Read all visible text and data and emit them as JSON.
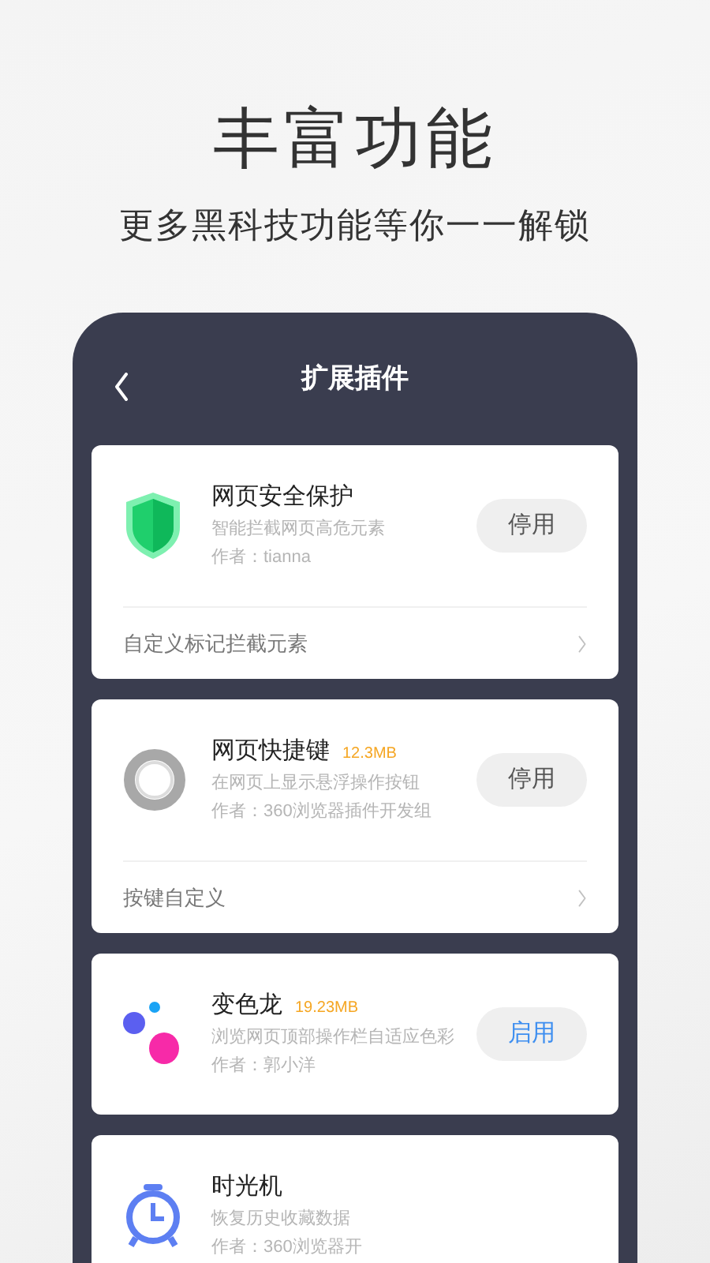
{
  "headline": "丰富功能",
  "subtitle": "更多黑科技功能等你一一解锁",
  "screen": {
    "title": "扩展插件",
    "plugins": [
      {
        "name": "网页安全保护",
        "description": "智能拦截网页高危元素",
        "author": "作者：tianna",
        "action": {
          "label": "停用",
          "active": true
        },
        "footer": "自定义标记拦截元素"
      },
      {
        "name": "网页快捷键",
        "size": "12.3MB",
        "description": "在网页上显示悬浮操作按钮",
        "author": "作者：360浏览器插件开发组",
        "action": {
          "label": "停用",
          "active": true
        },
        "footer": "按键自定义"
      },
      {
        "name": "变色龙",
        "size": "19.23MB",
        "description": "浏览网页顶部操作栏自适应色彩",
        "author": "作者：郭小洋",
        "action": {
          "label": "启用",
          "active": false
        }
      },
      {
        "name": "时光机",
        "description": "恢复历史收藏数据",
        "author": "作者：360浏览器开"
      }
    ]
  }
}
